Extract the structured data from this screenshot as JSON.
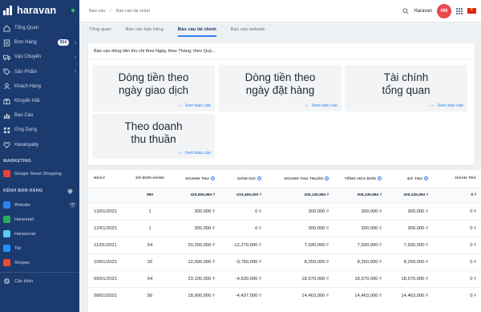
{
  "brand": {
    "name": "haravan"
  },
  "sidebar": {
    "items": [
      {
        "label": "Tổng Quan",
        "icon": "home-icon"
      },
      {
        "label": "Đơn Hàng",
        "icon": "orders-icon",
        "badge": "554",
        "chevron": "›"
      },
      {
        "label": "Vận Chuyển",
        "icon": "truck-icon",
        "chevron": "›"
      },
      {
        "label": "Sản Phẩm",
        "icon": "tag-icon",
        "chevron": "›"
      },
      {
        "label": "Khách Hàng",
        "icon": "users-icon"
      },
      {
        "label": "Khuyến Mãi",
        "icon": "promo-icon"
      },
      {
        "label": "Báo Cáo",
        "icon": "chart-icon"
      },
      {
        "label": "Ứng Dụng",
        "icon": "apps-icon"
      },
      {
        "label": "Haraloyalty",
        "icon": "loyalty-icon"
      }
    ],
    "marketing_title": "MARKETING",
    "marketing_items": [
      {
        "label": "Google Smart Shopping",
        "color": "#ea4335"
      }
    ],
    "channels_title": "KÊNH BÁN HÀNG",
    "channel_items": [
      {
        "label": "Website",
        "color": "#2f80ed",
        "tail": "👁"
      },
      {
        "label": "Hararetail",
        "color": "#27ae60"
      },
      {
        "label": "Harasocial",
        "color": "#56ccf2"
      },
      {
        "label": "Tiki",
        "color": "#1a94ff"
      },
      {
        "label": "Shopee",
        "color": "#ee4d2d"
      }
    ],
    "settings_label": "Cấu Hình"
  },
  "topbar": {
    "breadcrumb": [
      "Báo cáo",
      "Báo cáo tài chính"
    ],
    "user_name": "Haravan",
    "avatar_initials": "HN"
  },
  "tabs": [
    "Tổng quan",
    "Báo cáo bán hàng",
    "Báo cáo tài chính",
    "Báo cáo website"
  ],
  "active_tab": 2,
  "report_card": {
    "title": "Báo cáo dòng tiền thu chi theo Ngày, theo Tháng, theo Quý,...",
    "link_label": "Xem báo cáo",
    "tiles": [
      {
        "line1": "Dòng tiền theo",
        "line2": "ngày giao dịch"
      },
      {
        "line1": "Dòng tiền theo",
        "line2": "ngày đặt hàng"
      },
      {
        "line1": "Tài chính",
        "line2": "tổng quan"
      },
      {
        "line1": "Theo doanh",
        "line2": "thu thuần"
      }
    ]
  },
  "table": {
    "columns": [
      "NGÀY",
      "SỐ ĐƠN HÀNG",
      "DOANH THU",
      "GIẢM GIÁ",
      "DOANH THU THUẦN",
      "TỔNG HÓA ĐƠN",
      "ĐÃ THU",
      "HOÀN TRẢ"
    ],
    "info_columns": [
      2,
      3,
      4,
      5,
      6
    ],
    "total": [
      "",
      "990",
      "425,605,994 ₫",
      "-219,466,000 ₫",
      "206,139,994 ₫",
      "206,139,994 ₫",
      "206,439,994 ₫",
      "0 ₫"
    ],
    "rows": [
      [
        "13/01/2021",
        "1",
        "300,000 ₫",
        "0 ₫",
        "300,000 ₫",
        "300,000 ₫",
        "300,000 ₫",
        "0 ₫"
      ],
      [
        "12/01/2021",
        "1",
        "300,000 ₫",
        "0 ₫",
        "300,000 ₫",
        "300,000 ₫",
        "300,000 ₫",
        "0 ₫"
      ],
      [
        "11/01/2021",
        "54",
        "20,200,000 ₫",
        "-12,270,000 ₫",
        "7,930,000 ₫",
        "7,930,000 ₫",
        "7,930,000 ₫",
        "0 ₫"
      ],
      [
        "10/01/2021",
        "32",
        "12,000,000 ₫",
        "-3,750,000 ₫",
        "8,250,000 ₫",
        "8,250,000 ₫",
        "8,250,000 ₫",
        "0 ₫"
      ],
      [
        "09/01/2021",
        "54",
        "23,100,000 ₫",
        "-4,530,000 ₫",
        "18,570,000 ₫",
        "18,570,000 ₫",
        "18,570,000 ₫",
        "0 ₫"
      ],
      [
        "08/01/2021",
        "56",
        "18,900,000 ₫",
        "-4,437,000 ₫",
        "14,463,000 ₫",
        "14,463,000 ₫",
        "14,463,000 ₫",
        "0 ₫"
      ]
    ]
  }
}
